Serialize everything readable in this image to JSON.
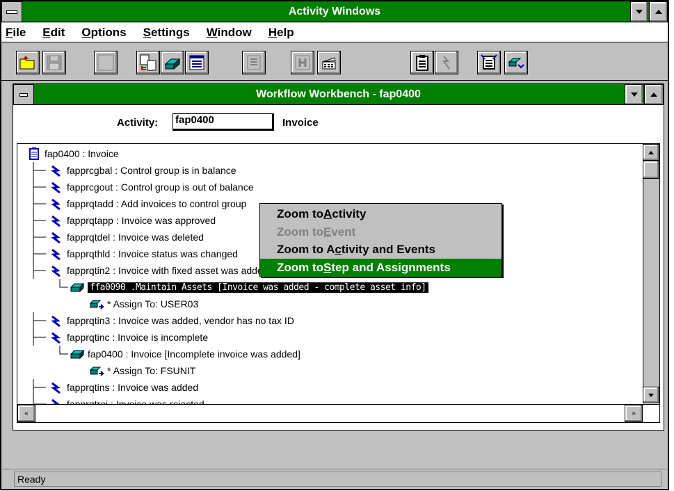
{
  "app": {
    "title": "Activity Windows",
    "menu": [
      "File",
      "Edit",
      "Options",
      "Settings",
      "Window",
      "Help"
    ],
    "toolbar_icons": [
      "open-folder-icon",
      "save-disk-icon",
      "blank-window-icon",
      "activity-tree-icon",
      "step-icon",
      "list-icon",
      "disabled-script-icon",
      "disabled-h-icon",
      "clapper-icon",
      "clipboard-doc-icon",
      "event-bolt-icon",
      "assign-doc-icon",
      "assign-step-icon"
    ],
    "status": "Ready"
  },
  "child": {
    "title": "Workflow Workbench - fap0400",
    "activity_label": "Activity:",
    "activity_value": "fap0400",
    "activity_desc": "Invoice"
  },
  "tree": {
    "root": "fap0400 : Invoice",
    "rows": [
      {
        "text": "fapprcgbal : Control group is in balance",
        "kind": "event"
      },
      {
        "text": "fapprcgout : Control group is out of balance",
        "kind": "event"
      },
      {
        "text": "fapprqtadd : Add invoices to control group",
        "kind": "event"
      },
      {
        "text": "fapprqtapp : Invoice was approved",
        "kind": "event"
      },
      {
        "text": "fapprqtdel : Invoice was deleted",
        "kind": "event"
      },
      {
        "text": "fapprqthld : Invoice status was changed",
        "kind": "event"
      },
      {
        "text": "fapprqtin2 : Invoice with fixed asset was added",
        "kind": "event"
      },
      {
        "text": "ffa0090 .Maintain Assets [Invoice was added - complete asset info]",
        "kind": "step"
      },
      {
        "text": "* Assign To: USER03",
        "kind": "assign"
      },
      {
        "text": "fapprqtin3 : Invoice was added, vendor has no tax ID",
        "kind": "event"
      },
      {
        "text": "fapprqtinc : Invoice is incomplete",
        "kind": "event"
      },
      {
        "text": "fap0400 : Invoice [Incomplete invoice was added]",
        "kind": "step"
      },
      {
        "text": "* Assign To: FSUNIT",
        "kind": "assign"
      },
      {
        "text": "fapprqtins : Invoice was added",
        "kind": "event"
      },
      {
        "text": "fapprqtrej : Invoice was rejected",
        "kind": "event"
      }
    ]
  },
  "context_menu": {
    "items": [
      {
        "pre": "Zoom to ",
        "ul": "A",
        "post": "ctivity",
        "state": "normal"
      },
      {
        "pre": "Zoom to ",
        "ul": "E",
        "post": "vent",
        "state": "disabled"
      },
      {
        "pre": "Zoom to A",
        "ul": "c",
        "post": "tivity and Events",
        "state": "normal"
      },
      {
        "pre": "Zoom to ",
        "ul": "S",
        "post": "tep and Assignments",
        "state": "selected"
      }
    ]
  },
  "colors": {
    "titlebar": "#008000",
    "event_icon": "#0000c0",
    "step_icon": "#008080"
  }
}
